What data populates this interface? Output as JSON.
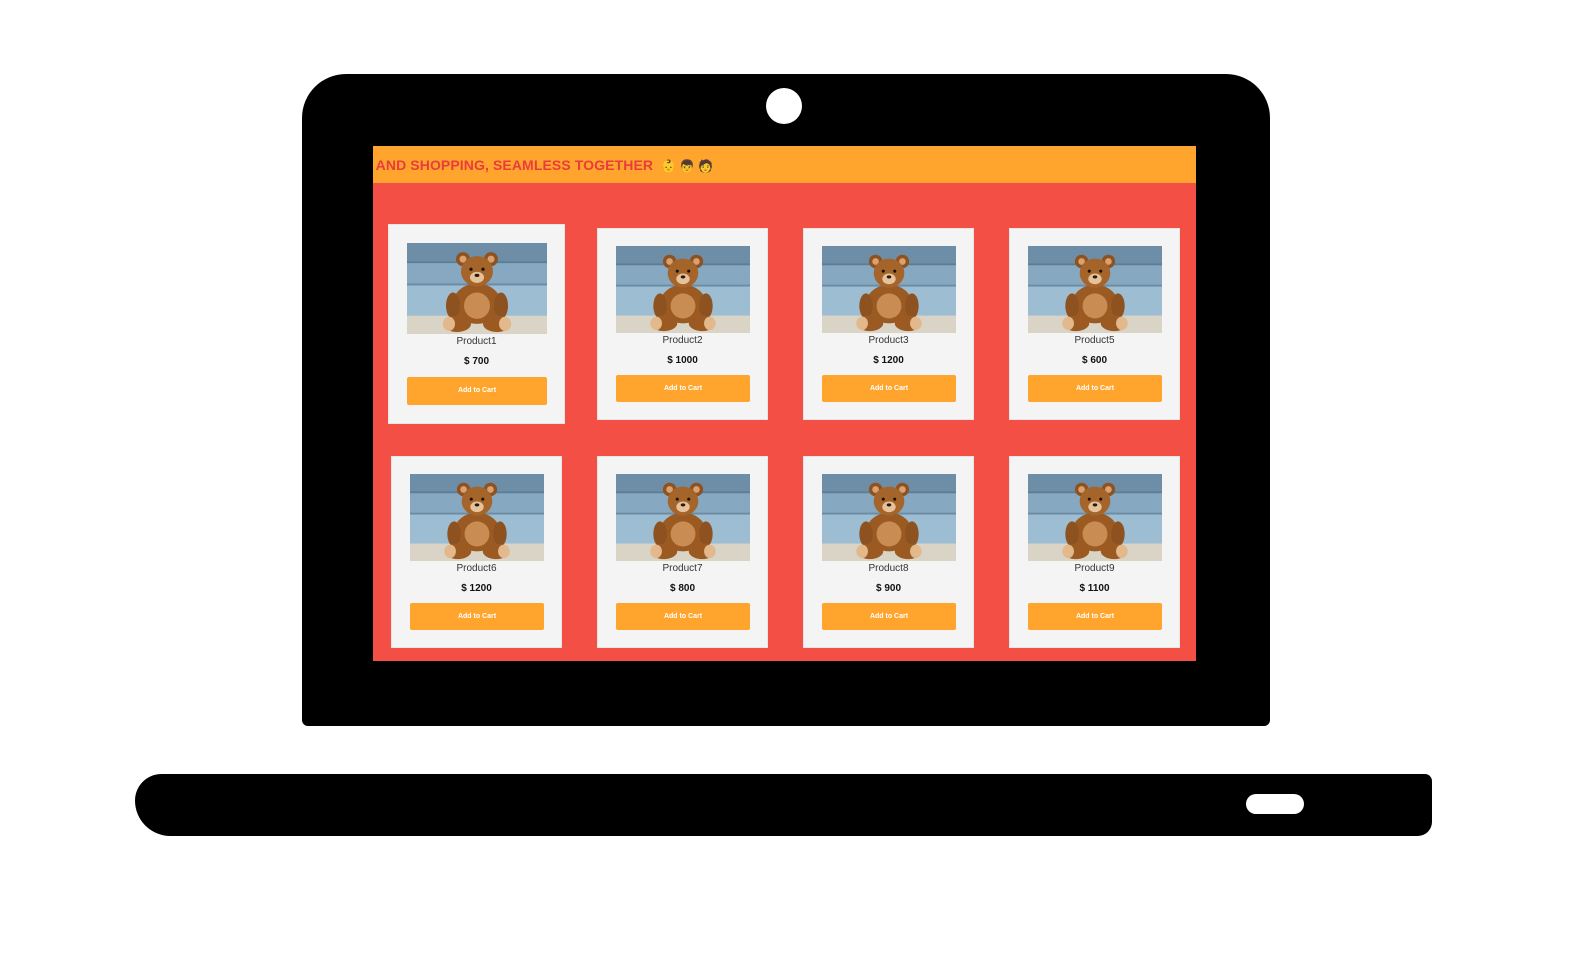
{
  "banner": {
    "text": "NG AND SHOPPING, SEAMLESS TOGETHER",
    "emoji": "👶 👦 🧑"
  },
  "products": [
    {
      "name": "Product1",
      "price": "$ 700",
      "button": "Add to Cart"
    },
    {
      "name": "Product2",
      "price": "$ 1000",
      "button": "Add to Cart"
    },
    {
      "name": "Product3",
      "price": "$ 1200",
      "button": "Add to Cart"
    },
    {
      "name": "Product5",
      "price": "$ 600",
      "button": "Add to Cart"
    },
    {
      "name": "Product6",
      "price": "$ 1200",
      "button": "Add to Cart"
    },
    {
      "name": "Product7",
      "price": "$ 800",
      "button": "Add to Cart"
    },
    {
      "name": "Product8",
      "price": "$ 900",
      "button": "Add to Cart"
    },
    {
      "name": "Product9",
      "price": "$ 1100",
      "button": "Add to Cart"
    }
  ],
  "colors": {
    "screen_bg": "#f44f44",
    "banner_bg": "#ffa42c",
    "banner_text": "#e93c3c",
    "card_bg": "#f4f4f4",
    "button_bg": "#ffa42c"
  },
  "icons": {
    "product_image": "teddy-bear-image",
    "camera": "webcam-icon"
  }
}
